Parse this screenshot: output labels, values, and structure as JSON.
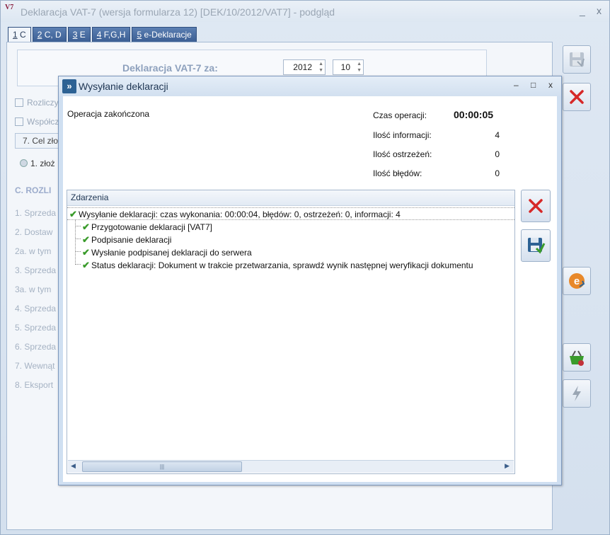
{
  "main": {
    "title": "Deklaracja VAT-7 (wersja formularza 12) [DEK/10/2012/VAT7] - podgląd",
    "icon_text": "V7",
    "minimize": "_",
    "close": "x",
    "tabs": [
      {
        "num": "1",
        "label": " C"
      },
      {
        "num": "2",
        "label": " C, D"
      },
      {
        "num": "3",
        "label": " E"
      },
      {
        "num": "4",
        "label": " F,G,H"
      },
      {
        "num": "5",
        "label": " e-Deklaracje"
      }
    ],
    "decl_label": "Deklaracja VAT-7 za:",
    "year": "2012",
    "month": "10",
    "row1": "Rozliczy",
    "row2": "Współcz",
    "cel": "7. Cel zło",
    "radio": "1. złoż",
    "c_heading": "C. ROZLI",
    "c_items": [
      "1. Sprzeda",
      "2. Dostaw",
      "2a. w tym",
      "3. Sprzeda",
      "3a. w tym",
      "4. Sprzeda",
      "5. Sprzeda",
      "6. Sprzeda",
      "7. Wewnąt",
      "8. Eksport"
    ]
  },
  "dialog": {
    "title": "Wysyłanie deklaracji",
    "minimize": "–",
    "maximize": "□",
    "close": "x",
    "status": "Operacja zakończona",
    "time_label": "Czas operacji:",
    "time_value": "00:00:05",
    "info_label": "Ilość informacji:",
    "info_value": "4",
    "warn_label": "Ilość ostrzeżeń:",
    "warn_value": "0",
    "err_label": "Ilość błędów:",
    "err_value": "0",
    "events_header": "Zdarzenia",
    "events": [
      "Wysyłanie deklaracji: czas wykonania: 00:00:04, błędów: 0, ostrzeżeń: 0, informacji: 4",
      "Przygotowanie deklaracji [VAT7]",
      "Podpisanie deklaracji",
      "Wysłanie podpisanej deklaracji do serwera",
      "Status deklaracji: Dokument w trakcie przetwarzania, sprawdź wynik następnej weryfikacji dokumentu"
    ]
  },
  "colors": {
    "accent": "#3c5f94",
    "check": "#3a9b2b",
    "cancel": "#d62828"
  }
}
